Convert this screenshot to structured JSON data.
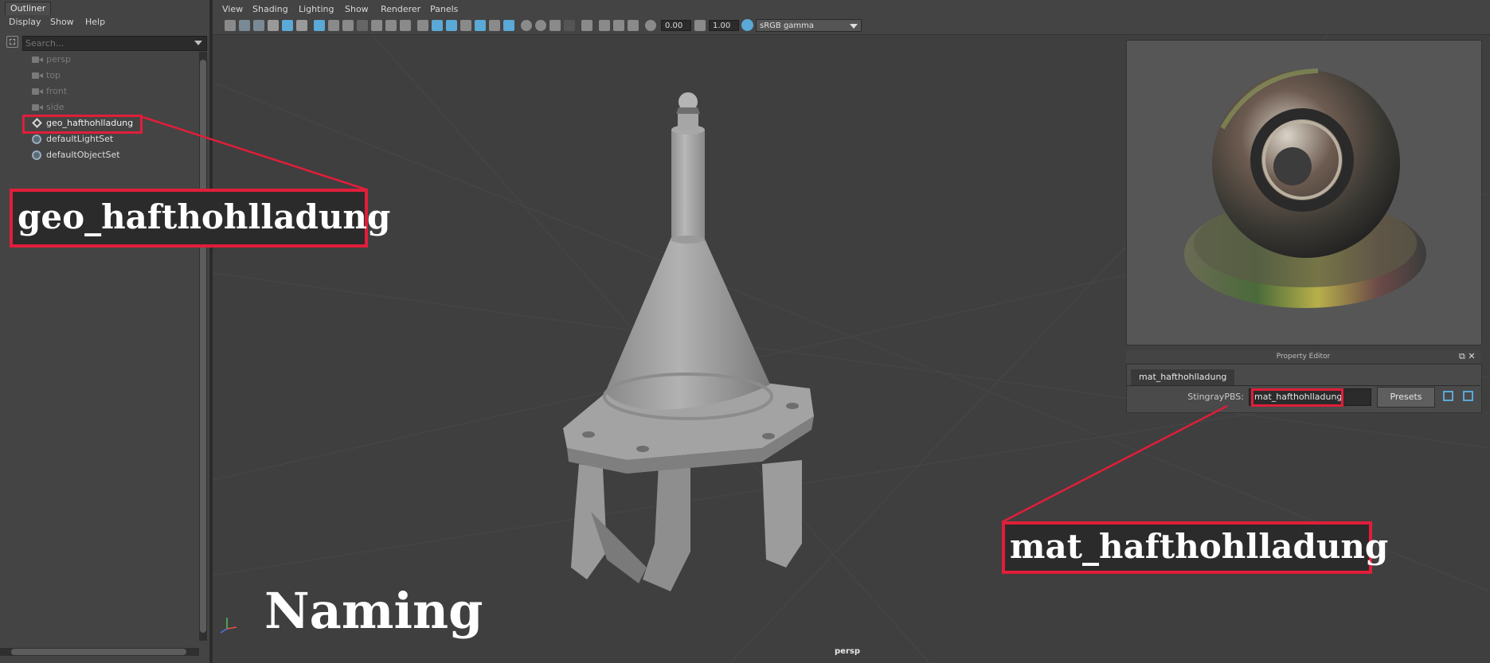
{
  "outliner": {
    "title": "Outliner",
    "menu": [
      "Display",
      "Show",
      "Help"
    ],
    "search_placeholder": "Search...",
    "items": [
      {
        "label": "persp",
        "icon": "camera-icon"
      },
      {
        "label": "top",
        "icon": "camera-icon"
      },
      {
        "label": "front",
        "icon": "camera-icon"
      },
      {
        "label": "side",
        "icon": "camera-icon"
      },
      {
        "label": "geo_hafthohlladung",
        "icon": "mesh-transform-icon"
      },
      {
        "label": "defaultLightSet",
        "icon": "object-set-icon"
      },
      {
        "label": "defaultObjectSet",
        "icon": "object-set-icon"
      }
    ]
  },
  "viewport": {
    "menu": [
      "View",
      "Shading",
      "Lighting",
      "Show",
      "Renderer",
      "Panels"
    ],
    "exposure": "0.00",
    "gamma": "1.00",
    "color_space": "sRGB gamma",
    "camera_label": "persp"
  },
  "property_editor": {
    "title": "Property Editor",
    "tab": "mat_hafthohlladung",
    "field_label": "StingrayPBS:",
    "field_value": "mat_hafthohlladung",
    "presets_label": "Presets"
  },
  "annotations": {
    "geo_callout": "geo_hafthohlladung",
    "mat_callout": "mat_hafthohlladung",
    "heading": "Naming"
  },
  "colors": {
    "annotation_red": "#e01e3a",
    "accent_blue": "#5aa9d6"
  }
}
